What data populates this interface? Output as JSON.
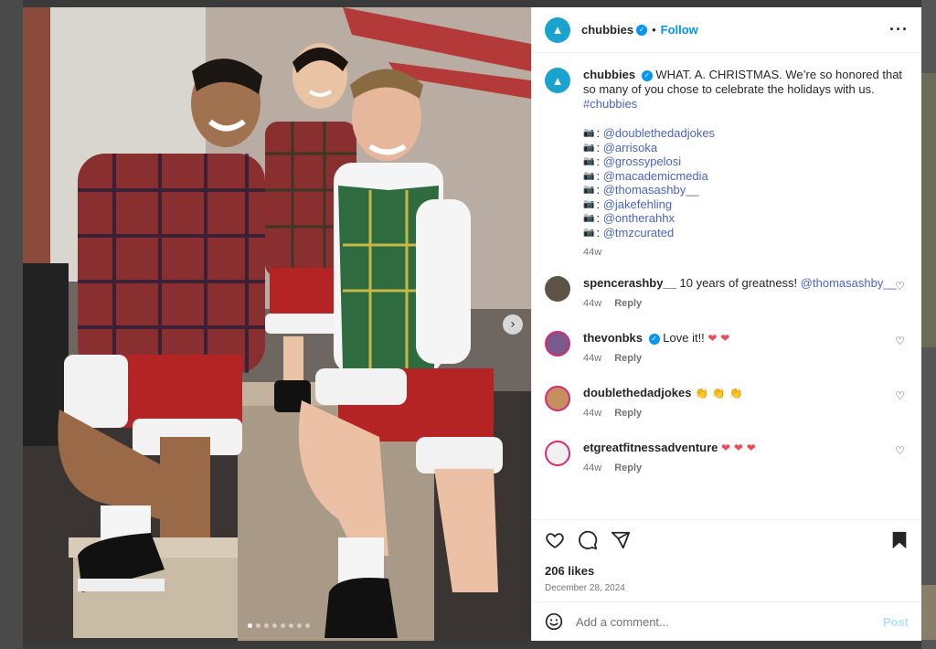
{
  "post": {
    "username": "chubbies",
    "follow_label": "Follow",
    "bullet": "•",
    "more_icon": "more-horizontal-icon",
    "caption_text": "WHAT. A. CHRISTMAS. We’re so honored that so many of you chose to celebrate the holidays with us.",
    "caption_hashtag": "#chubbies",
    "credit_icon": "camera-icon",
    "credit_prefix": ":",
    "credits": [
      "@doublethedadjokes",
      "@arrisoka",
      "@grossypelosi",
      "@macademicmedia",
      "@thomasashby__",
      "@jakefehling",
      "@ontherahhx",
      "@tmzcurated"
    ],
    "caption_time": "44w"
  },
  "comments": [
    {
      "user": "spencerashby__",
      "verified": false,
      "text": "10 years of greatness!",
      "mention": "@thomasashby__",
      "emoji": "",
      "time": "44w",
      "reply": "Reply"
    },
    {
      "user": "thevonbks",
      "verified": true,
      "text": "Love it!!",
      "mention": "",
      "emoji": "❤ ❤",
      "time": "44w",
      "reply": "Reply"
    },
    {
      "user": "doublethedadjokes",
      "verified": false,
      "text": "",
      "mention": "",
      "emoji": "👏 👏 👏",
      "time": "44w",
      "reply": "Reply"
    },
    {
      "user": "etgreatfitnessadventure",
      "verified": false,
      "text": "",
      "mention": "",
      "emoji": "❤ ❤ ❤",
      "time": "44w",
      "reply": "Reply"
    }
  ],
  "actions": {
    "likes": "206 likes",
    "date": "December 28, 2024"
  },
  "add_comment": {
    "placeholder": "Add a comment...",
    "post_label": "Post"
  },
  "carousel": {
    "next_icon": "chevron-right-icon",
    "slide_count": 8,
    "active_slide": 1
  },
  "colors": {
    "accent": "#0095f6",
    "link": "#00376b",
    "hashtag": "#4a64c8",
    "heart": "#ed4956",
    "brand_avatar": "#1aa3cf"
  }
}
